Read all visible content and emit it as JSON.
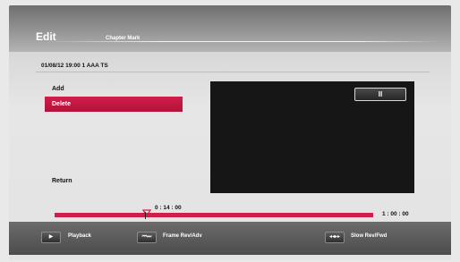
{
  "header": {
    "title": "Edit",
    "subtitle": "Chapter Mark"
  },
  "recording": {
    "info": "01/08/12  19:00  1 AAA  TS"
  },
  "menu": {
    "add_label": "Add",
    "delete_label": "Delete",
    "return_label": "Return"
  },
  "preview": {
    "pause_symbol": "II"
  },
  "timeline": {
    "marker_time": "0 : 14 : 00",
    "total_time": "1 : 00 : 00",
    "marker_fraction": 0.2333,
    "accent_color": "#d01e4a"
  },
  "footer": {
    "playback_label": "Playback",
    "playback_icon": "play-icon",
    "frame_label": "Frame Rev/Adv",
    "frame_icon": "skip-icon",
    "slow_label": "Slow Rev/Fwd",
    "slow_icon": "slow-icon"
  }
}
